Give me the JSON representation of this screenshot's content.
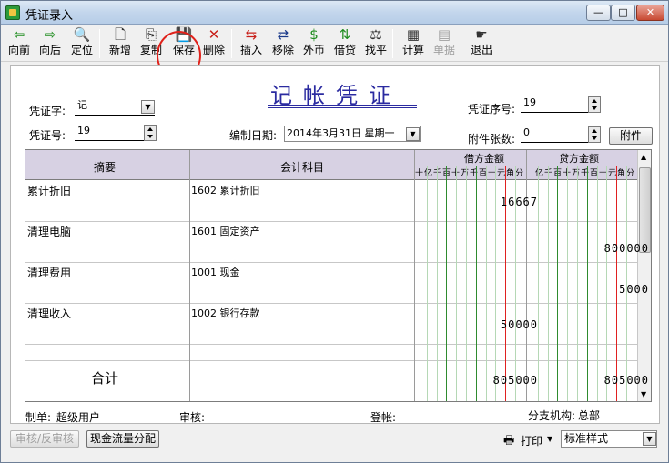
{
  "window": {
    "title": "凭证录入",
    "min": "—",
    "max": "□",
    "close": "✕"
  },
  "toolbar": [
    {
      "label": "向前",
      "icon": "arrow-left-icon",
      "glyph": "⇦",
      "color": "#1e8c1e"
    },
    {
      "label": "向后",
      "icon": "arrow-right-icon",
      "glyph": "⇨",
      "color": "#1e8c1e"
    },
    {
      "label": "定位",
      "icon": "locate-icon",
      "glyph": "🔍",
      "color": "#333333"
    },
    {
      "label": "新增",
      "icon": "new-doc-icon",
      "glyph": "🗋",
      "color": "#333333"
    },
    {
      "label": "复制",
      "icon": "copy-icon",
      "glyph": "⎘",
      "color": "#333333"
    },
    {
      "label": "保存",
      "icon": "save-icon",
      "glyph": "💾",
      "color": "#1b3a8a"
    },
    {
      "label": "删除",
      "icon": "delete-icon",
      "glyph": "✕",
      "color": "#c8201a"
    },
    {
      "label": "插入",
      "icon": "insert-icon",
      "glyph": "⇆",
      "color": "#c8201a"
    },
    {
      "label": "移除",
      "icon": "remove-icon",
      "glyph": "⇄",
      "color": "#1b3a8a"
    },
    {
      "label": "外币",
      "icon": "currency-icon",
      "glyph": "$",
      "color": "#1e8c1e"
    },
    {
      "label": "借贷",
      "icon": "debit-credit-icon",
      "glyph": "⇅",
      "color": "#1e8c1e"
    },
    {
      "label": "找平",
      "icon": "balance-icon",
      "glyph": "⚖",
      "color": "#333333"
    },
    {
      "label": "计算",
      "icon": "calculator-icon",
      "glyph": "▦",
      "color": "#333333"
    },
    {
      "label": "单据",
      "icon": "document-icon",
      "glyph": "▤",
      "color": "#a0a0a0"
    },
    {
      "label": "退出",
      "icon": "exit-icon",
      "glyph": "☛",
      "color": "#333333"
    }
  ],
  "voucher": {
    "title": "记帐凭证",
    "word_label": "凭证字:",
    "word_value": "记",
    "seq_label": "凭证序号:",
    "seq_value": "19",
    "num_label": "凭证号:",
    "num_value": "19",
    "date_label": "编制日期:",
    "date_value": "2014年3月31日  星期一",
    "attach_label": "附件张数:",
    "attach_value": "0",
    "attach_button": "附件"
  },
  "grid": {
    "col_summary": "摘要",
    "col_account": "会计科目",
    "col_debit": "借方金额",
    "col_credit": "贷方金额",
    "digits_debit": "十亿千百十万千百十元角分",
    "digits_credit": "亿千百十万千百十元角分",
    "rows": [
      {
        "summary": "累计折旧",
        "account": "1602  累计折旧",
        "debit": "16667",
        "credit": ""
      },
      {
        "summary": "清理电脑",
        "account": "1601  固定资产",
        "debit": "",
        "credit": "800000"
      },
      {
        "summary": "清理费用",
        "account": "1001  现金",
        "debit": "",
        "credit": "5000"
      },
      {
        "summary": "清理收入",
        "account": "1002  银行存款",
        "debit": "50000",
        "credit": ""
      }
    ],
    "total_label": "合计",
    "total_debit": "805000",
    "total_credit": "805000"
  },
  "footer": {
    "maker_label": "制单:",
    "maker_value": "超级用户",
    "review_label": "审核:",
    "post_label": "登帐:",
    "branch_label": "分支机构:",
    "branch_value": "总部",
    "review_btn": "审核/反审核",
    "cashflow_btn": "现金流量分配",
    "print_label": "打印",
    "style_value": "标准样式"
  }
}
